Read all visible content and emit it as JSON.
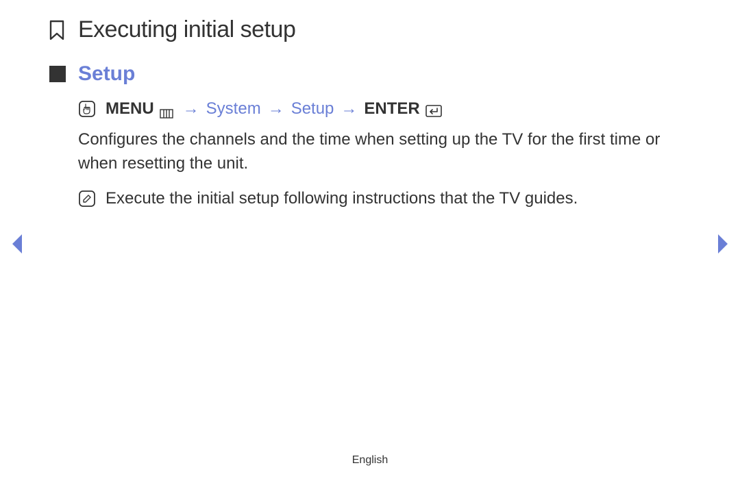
{
  "colors": {
    "accent": "#6a7fd6",
    "text": "#333333"
  },
  "page": {
    "title": "Executing initial setup"
  },
  "section": {
    "title": "Setup"
  },
  "breadcrumb": {
    "menu_label": "MENU",
    "sep": "→",
    "item_system": "System",
    "item_setup": "Setup",
    "enter_label": "ENTER"
  },
  "body": {
    "description": "Configures the channels and the time when setting up the TV for the first time or when resetting the unit.",
    "note": "Execute the initial setup following instructions that the TV guides."
  },
  "footer": {
    "language": "English"
  }
}
